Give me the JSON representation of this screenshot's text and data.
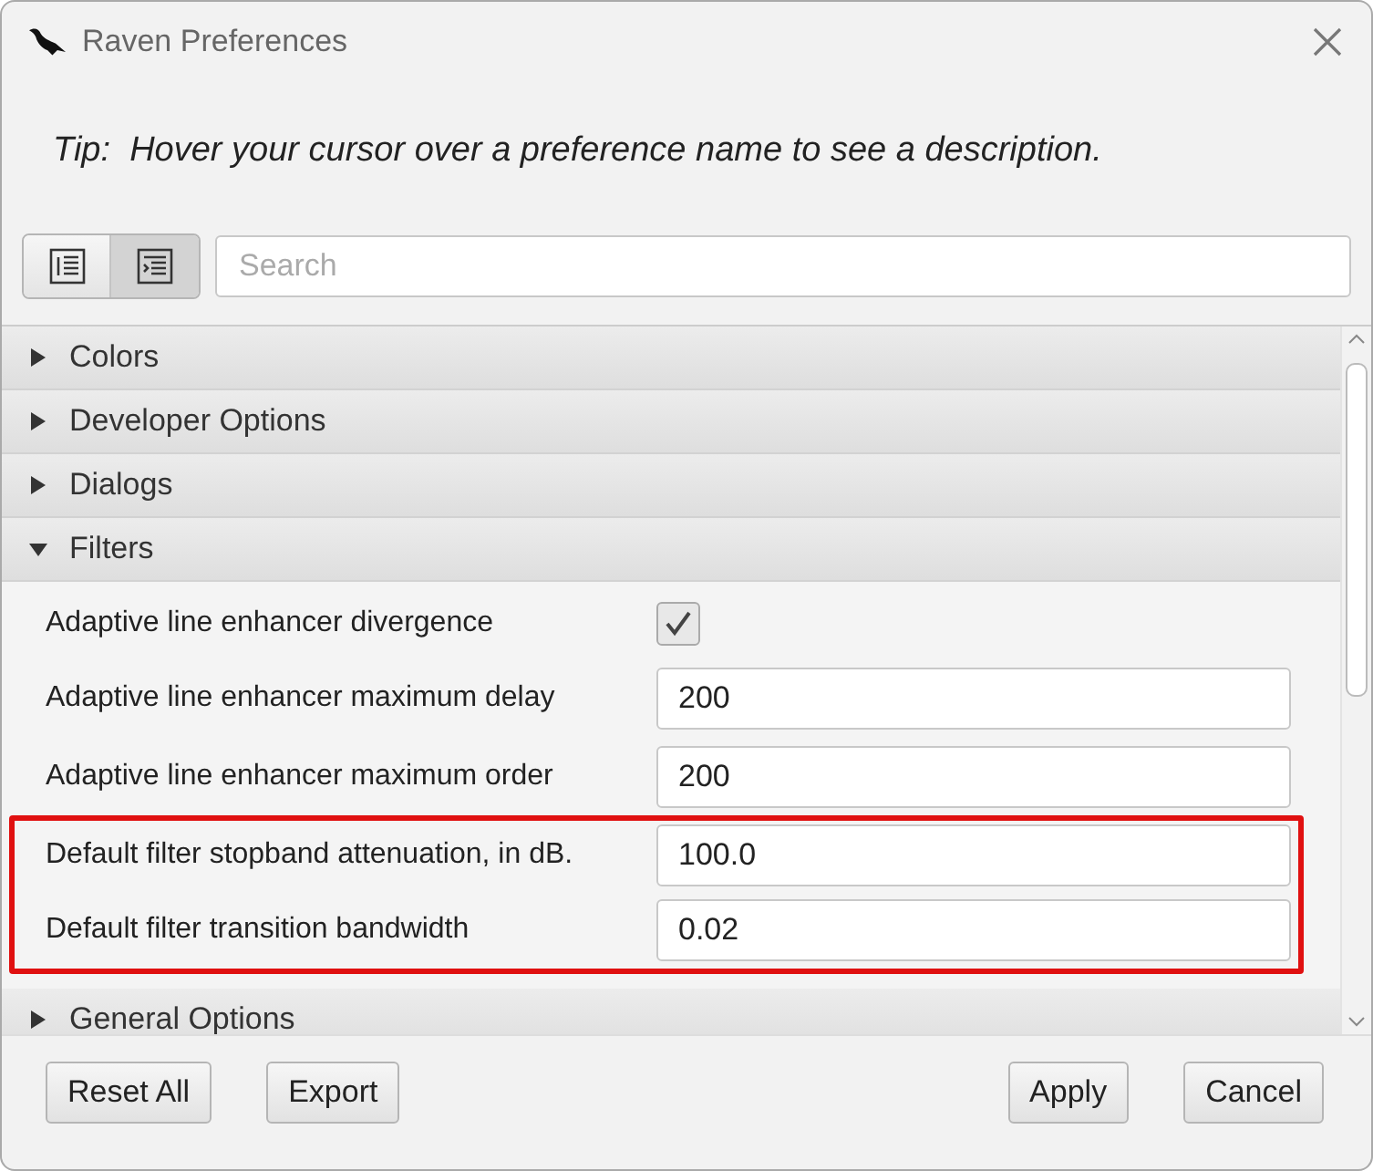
{
  "window": {
    "title": "Raven Preferences"
  },
  "tip": "Tip:  Hover your cursor over a preference name to see a description.",
  "view_buttons": [
    {
      "selected": false
    },
    {
      "selected": true
    }
  ],
  "search": {
    "placeholder": "Search"
  },
  "sections": [
    {
      "label": "Colors",
      "expanded": false
    },
    {
      "label": "Developer Options",
      "expanded": false
    },
    {
      "label": "Dialogs",
      "expanded": false
    },
    {
      "label": "Filters",
      "expanded": true,
      "settings": [
        {
          "kind": "checkbox",
          "name": "Adaptive line enhancer divergence",
          "checked": true,
          "highlighted": false
        },
        {
          "kind": "text",
          "name": "Adaptive line enhancer maximum delay",
          "value": "200",
          "highlighted": false
        },
        {
          "kind": "text",
          "name": "Adaptive line enhancer maximum order",
          "value": "200",
          "highlighted": false
        },
        {
          "kind": "text",
          "name": "Default filter stopband attenuation, in dB.",
          "value": "100.0",
          "highlighted": true
        },
        {
          "kind": "text",
          "name": "Default filter transition bandwidth",
          "value": "0.02",
          "highlighted": true
        }
      ]
    },
    {
      "label": "General Options",
      "expanded": false
    }
  ],
  "buttons_left": [
    "Reset All",
    "Export"
  ],
  "buttons_right": [
    "Apply",
    "Cancel"
  ]
}
